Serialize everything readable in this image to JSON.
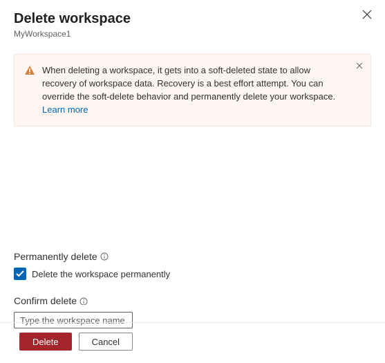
{
  "header": {
    "title": "Delete workspace",
    "subtitle": "MyWorkspace1"
  },
  "alert": {
    "text": "When deleting a workspace, it gets into a soft-deleted state to allow recovery of workspace data. Recovery is a best effort attempt. You can override the soft-delete behavior and permanently delete your workspace. ",
    "link_label": "Learn more"
  },
  "form": {
    "permanent_label": "Permanently delete",
    "checkbox_label": "Delete the workspace permanently",
    "checkbox_checked": true,
    "confirm_label": "Confirm delete",
    "confirm_placeholder": "Type the workspace name",
    "confirm_value": ""
  },
  "footer": {
    "primary_label": "Delete",
    "secondary_label": "Cancel"
  },
  "colors": {
    "danger": "#a4262c",
    "link": "#0067b8",
    "alert_bg": "#fdf6f3"
  }
}
